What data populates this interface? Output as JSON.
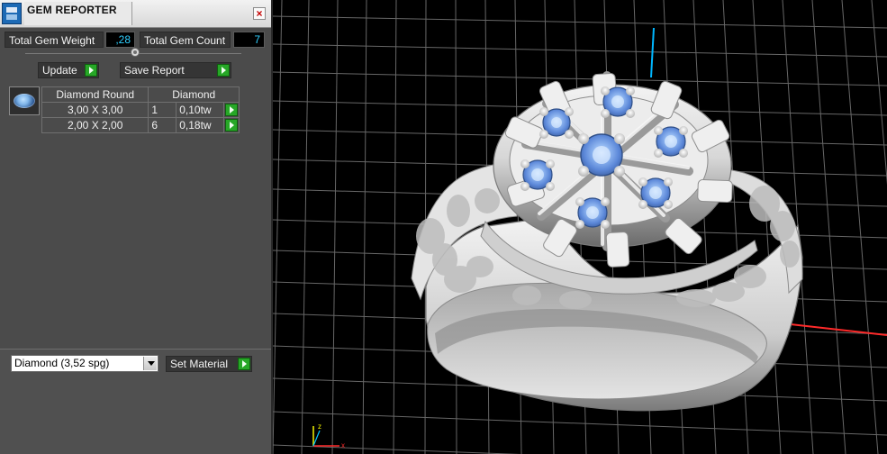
{
  "window": {
    "title": "GEM REPORTER"
  },
  "summary": {
    "total_gem_weight_label": "Total Gem Weight",
    "total_gem_weight_value": ",28",
    "total_gem_count_label": "Total Gem Count",
    "total_gem_count_value": "7"
  },
  "actions": {
    "update_label": "Update",
    "save_report_label": "Save Report",
    "set_material_label": "Set Material"
  },
  "gem_table": {
    "headers": {
      "shape": "Diamond Round",
      "material": "Diamond"
    },
    "rows": [
      {
        "size": "3,00 X 3,00",
        "count": "1",
        "weight": "0,10tw"
      },
      {
        "size": "2,00 X 2,00",
        "count": "6",
        "weight": "0,18tw"
      }
    ]
  },
  "material_select": {
    "selected": "Diamond      (3,52 spg)"
  },
  "colors": {
    "panel_bg": "#4b4b4b",
    "value_text": "#2ecfff",
    "accent_green": "#27a727",
    "grid_line": "#707070",
    "axis_cyan": "#00b7ff",
    "axis_red": "#ff2a2a",
    "gem_blue": "#76a5ea"
  },
  "icons": {
    "app": "app-icon",
    "close": "close-icon",
    "gem_thumbnail": "gem-thumbnail-icon",
    "dropdown": "chevron-down-icon",
    "play": "play-icon"
  }
}
